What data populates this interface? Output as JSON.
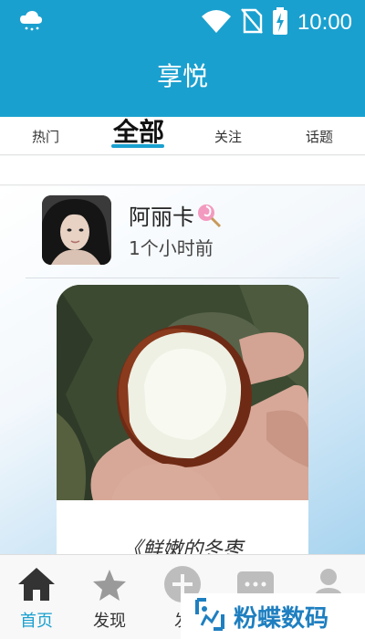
{
  "status_bar": {
    "time": "10:00",
    "icons": [
      "cloud-icon",
      "wifi-icon",
      "no-sim-icon",
      "battery-charging-icon"
    ]
  },
  "header": {
    "title": "享悦"
  },
  "tabs": [
    {
      "label": "热门",
      "active": false
    },
    {
      "label": "全部",
      "active": true
    },
    {
      "label": "关注",
      "active": false
    },
    {
      "label": "话题",
      "active": false
    }
  ],
  "post": {
    "user_name": "阿丽卡",
    "time_ago": "1个小时前",
    "caption": "《鲜嫩的冬枣"
  },
  "bottom_nav": [
    {
      "label": "首页",
      "icon": "home-icon",
      "active": true
    },
    {
      "label": "发现",
      "icon": "discover-icon",
      "active": false
    },
    {
      "label": "发",
      "icon": "add-icon",
      "active": false
    },
    {
      "label": "",
      "icon": "message-icon",
      "active": false
    },
    {
      "label": "",
      "icon": "profile-icon",
      "active": false
    }
  ],
  "watermark": {
    "text": "粉蝶数码"
  },
  "colors": {
    "primary": "#1aa0cf",
    "watermark": "#1e7fc0"
  }
}
